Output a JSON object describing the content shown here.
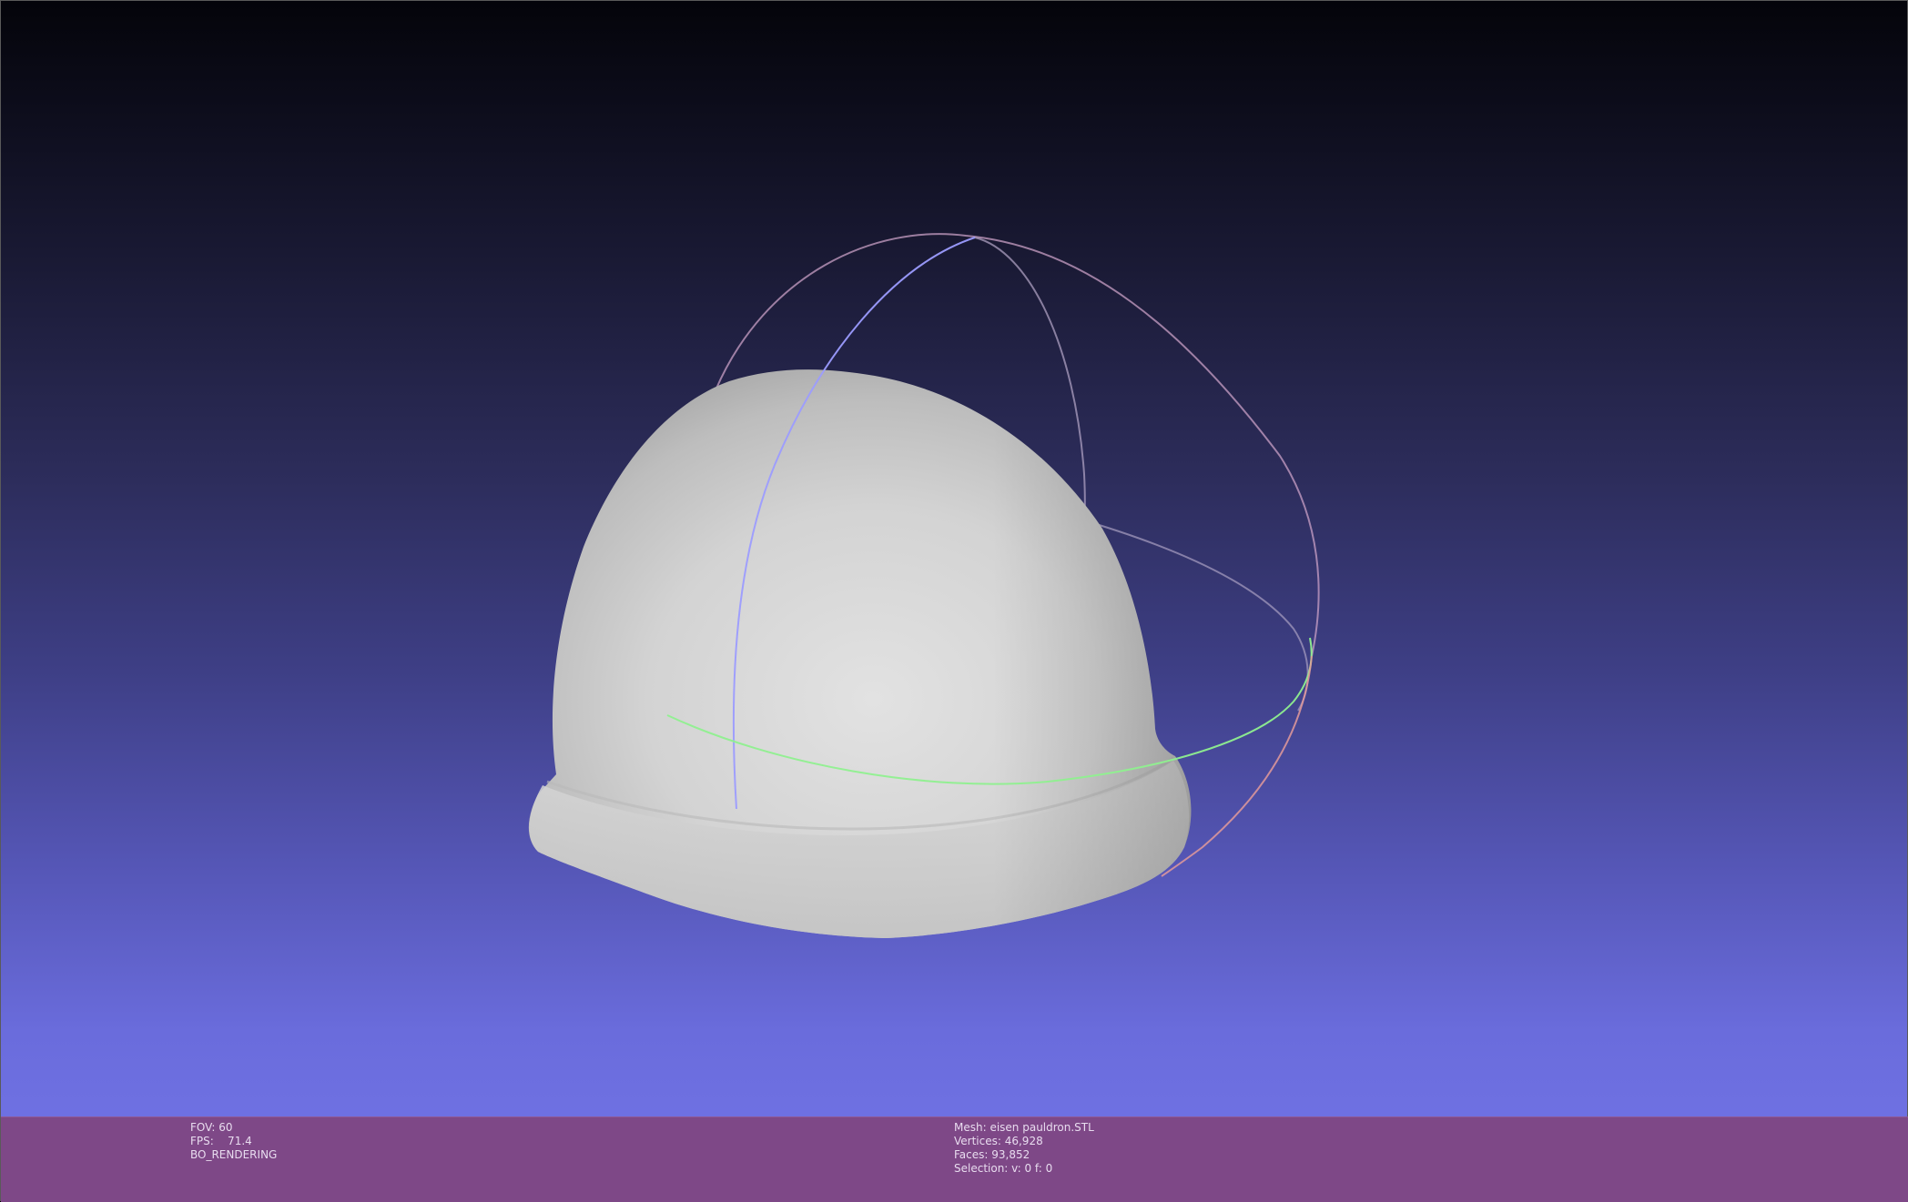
{
  "viewer": {
    "left_info": {
      "fov": "FOV: 60",
      "fps": "FPS:    71.4",
      "mode": "BO_RENDERING"
    },
    "right_info": {
      "mesh": "Mesh: eisen pauldron.STL",
      "vertices": "Vertices: 46,928",
      "faces": "Faces: 93,852",
      "selection": "Selection: v: 0 f: 0"
    }
  },
  "colors": {
    "info_bar": "#7e4887",
    "mesh": "#d9d9d9",
    "trackball_x": "#e09090",
    "trackball_y": "#8fef8f",
    "trackball_z": "#9a9aff"
  },
  "icons": {
    "trackball": "trackball-gizmo-icon"
  }
}
